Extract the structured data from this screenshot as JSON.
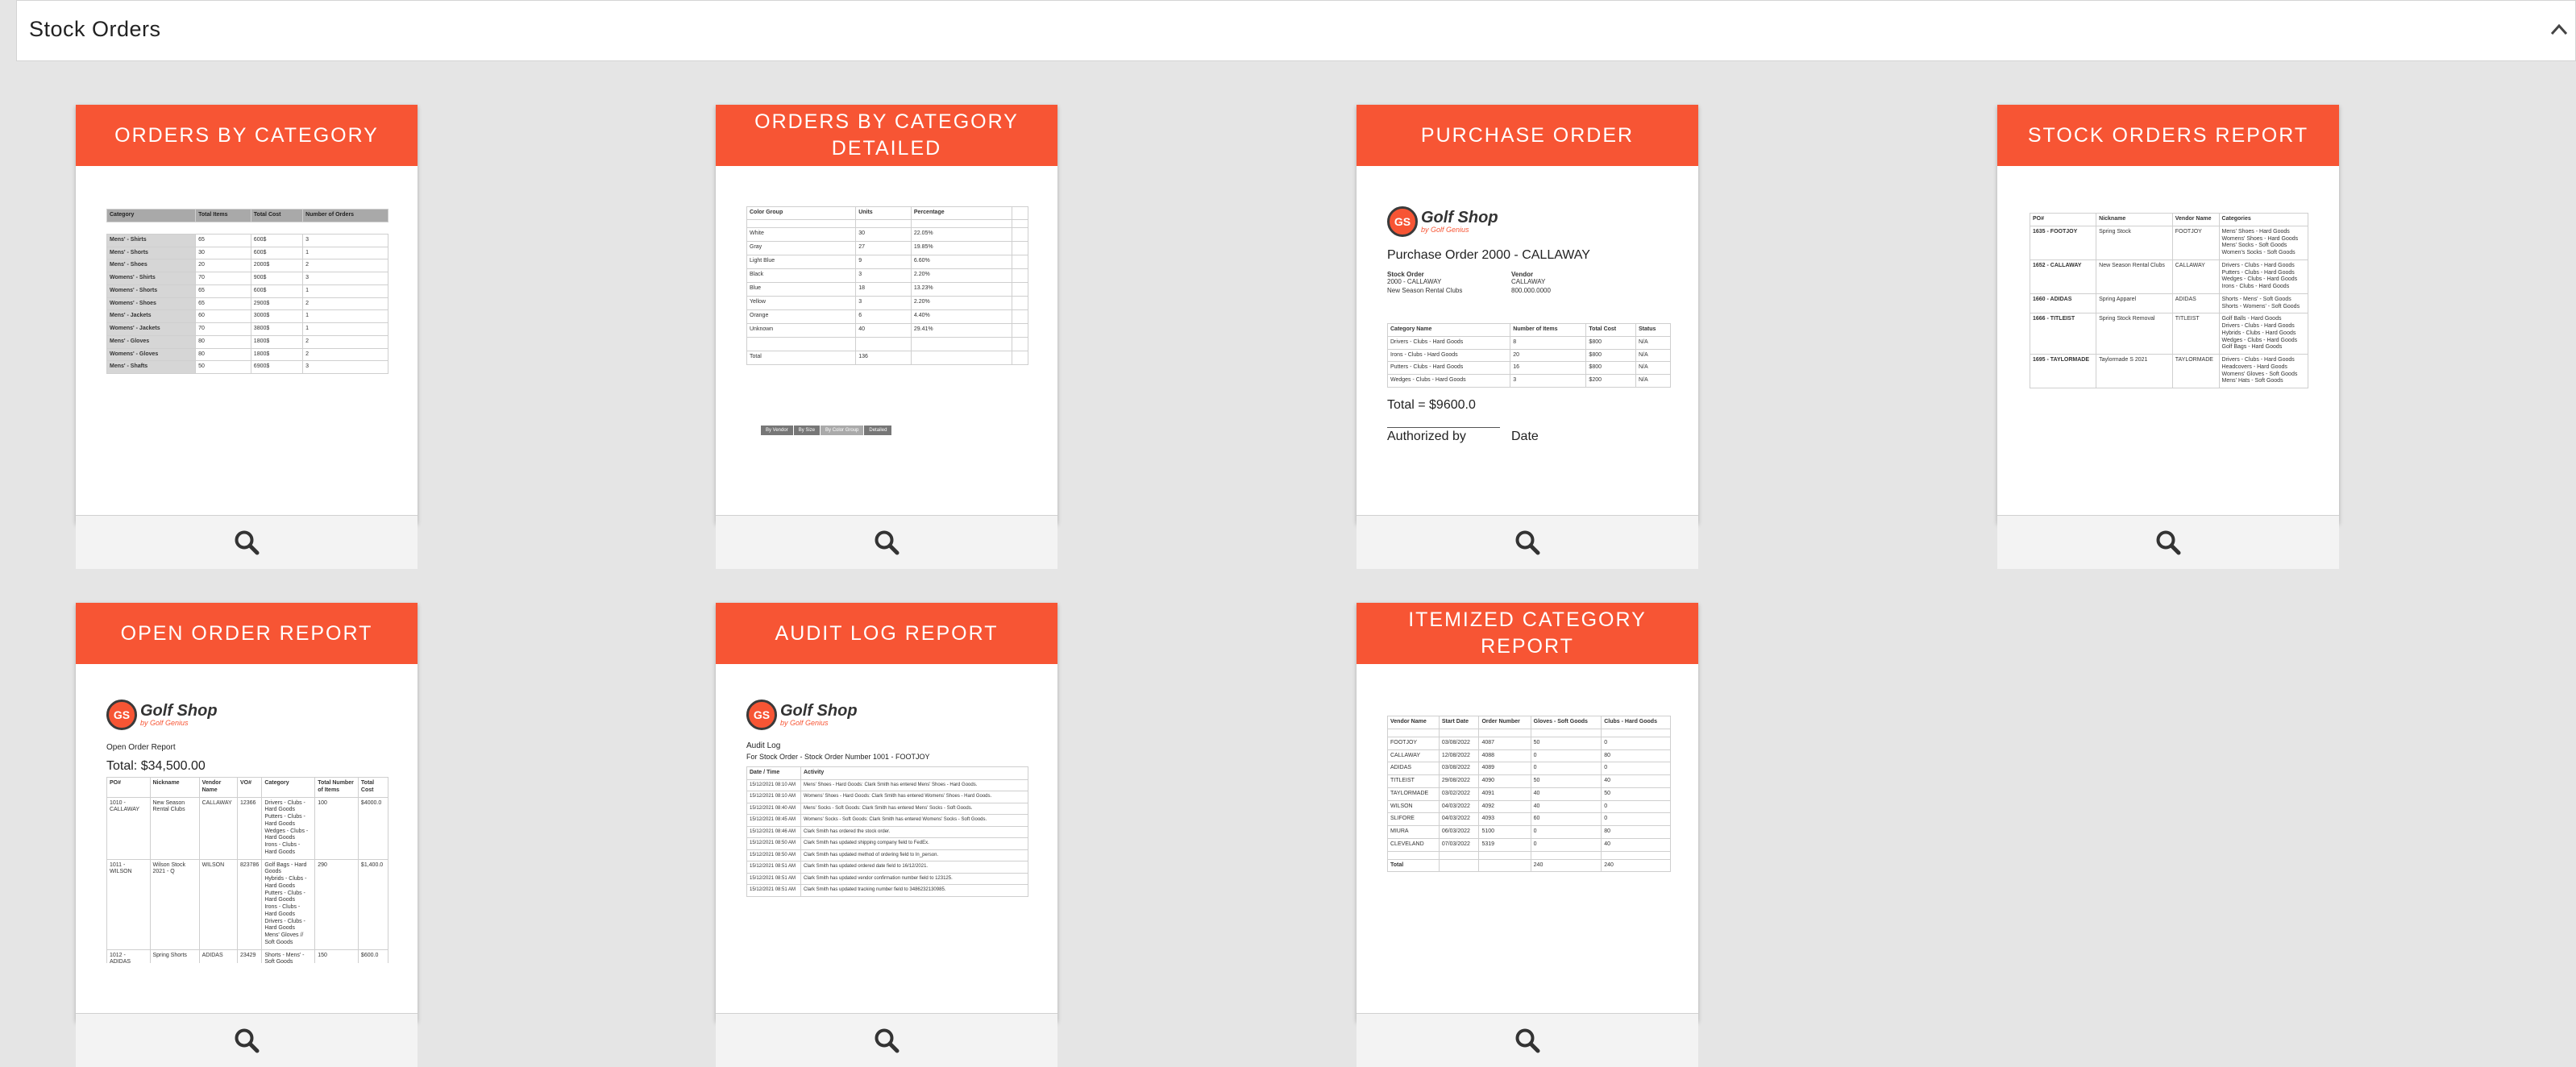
{
  "panel": {
    "title": "Stock Orders",
    "collapse_icon": "chevron-up-icon"
  },
  "accent_color": "#f75534",
  "search_icon": "magnifier-icon",
  "cards": [
    {
      "title": "ORDERS BY CATEGORY",
      "table": {
        "headers": [
          "Category",
          "Total Items",
          "Total Cost",
          "Number of Orders"
        ],
        "rows": [
          [
            "Mens' - Shirts",
            "65",
            "600$",
            "3"
          ],
          [
            "Mens' - Shorts",
            "30",
            "600$",
            "1"
          ],
          [
            "Mens' - Shoes",
            "20",
            "2000$",
            "2"
          ],
          [
            "Womens' - Shirts",
            "70",
            "900$",
            "3"
          ],
          [
            "Womens' - Shorts",
            "65",
            "600$",
            "1"
          ],
          [
            "Womens' - Shoes",
            "65",
            "2900$",
            "2"
          ],
          [
            "Mens' - Jackets",
            "60",
            "3000$",
            "1"
          ],
          [
            "Womens' - Jackets",
            "70",
            "3800$",
            "1"
          ],
          [
            "Mens' - Gloves",
            "80",
            "1800$",
            "2"
          ],
          [
            "Womens' - Gloves",
            "80",
            "1800$",
            "2"
          ],
          [
            "Mens' - Shafts",
            "50",
            "6900$",
            "3"
          ]
        ]
      }
    },
    {
      "title": "ORDERS BY CATEGORY DETAILED",
      "table": {
        "headers": [
          "Color Group",
          "Units",
          "Percentage",
          ""
        ],
        "rows": [
          [
            "White",
            "30",
            "22.05%",
            ""
          ],
          [
            "Gray",
            "27",
            "19.85%",
            ""
          ],
          [
            "Light Blue",
            "9",
            "6.60%",
            ""
          ],
          [
            "Black",
            "3",
            "2.20%",
            ""
          ],
          [
            "Blue",
            "18",
            "13.23%",
            ""
          ],
          [
            "Yellow",
            "3",
            "2.20%",
            ""
          ],
          [
            "Orange",
            "6",
            "4.40%",
            ""
          ],
          [
            "Unknown",
            "40",
            "29.41%",
            ""
          ]
        ],
        "total_label": "Total",
        "total_value": "136"
      },
      "buttons": [
        "By Vendor",
        "By Size",
        "By Color Group",
        "Detailed"
      ]
    },
    {
      "title": "PURCHASE ORDER",
      "logo": {
        "initials": "GS",
        "name": "Golf Shop",
        "sub": "by Golf Genius"
      },
      "heading": "Purchase Order 2000 - CALLAWAY",
      "stock_order_label": "Stock Order",
      "stock_order_lines": [
        "2000 - CALLAWAY",
        "New Season Rental Clubs"
      ],
      "vendor_label": "Vendor",
      "vendor_lines": [
        "CALLAWAY",
        "800.000.0000"
      ],
      "table": {
        "headers": [
          "Category Name",
          "Number of Items",
          "Total Cost",
          "Status"
        ],
        "rows": [
          [
            "Drivers - Clubs - Hard Goods",
            "8",
            "$800",
            "N/A"
          ],
          [
            "Irons - Clubs - Hard Goods",
            "20",
            "$800",
            "N/A"
          ],
          [
            "Putters - Clubs - Hard Goods",
            "16",
            "$800",
            "N/A"
          ],
          [
            "Wedges - Clubs - Hard Goods",
            "3",
            "$200",
            "N/A"
          ]
        ]
      },
      "total": "Total = $9600.0",
      "authorized_by": "Authorized by",
      "date": "Date"
    },
    {
      "title": "STOCK ORDERS REPORT",
      "table": {
        "headers": [
          "PO#",
          "Nickname",
          "Vendor Name",
          "Categories"
        ],
        "rows": [
          [
            "1635 - FOOTJOY",
            "Spring Stock",
            "FOOTJOY",
            "Mens' Shoes - Hard Goods\nWomens' Shoes - Hard Goods\nMens' Socks - Soft Goods\nWomen's Socks - Soft Goods"
          ],
          [
            "1652 - CALLAWAY",
            "New Season Rental Clubs",
            "CALLAWAY",
            "Drivers - Clubs - Hard Goods\nPutters - Clubs - Hard Goods\nWedges - Clubs - Hard Goods\nIrons - Clubs - Hard Goods"
          ],
          [
            "1660 - ADIDAS",
            "Spring Apparel",
            "ADIDAS",
            "Shorts - Mens' - Soft Goods\nShorts - Womens' - Soft Goods"
          ],
          [
            "1666 - TITLEIST",
            "Spring Stock Removal",
            "TITLEIST",
            "Golf Balls - Hard Goods\nDrivers - Clubs - Hard Goods\nHybrids - Clubs - Hard Goods\nWedges - Clubs - Hard Goods\nGolf Bags - Hard Goods"
          ],
          [
            "1695 - TAYLORMADE",
            "Taylormade S 2021",
            "TAYLORMADE",
            "Drivers - Clubs - Hard Goods\nHeadcovers - Hard Goods\nWomens' Gloves - Soft Goods\nMens' Hats - Soft Goods"
          ]
        ]
      }
    },
    {
      "title": "OPEN ORDER REPORT",
      "logo": {
        "initials": "GS",
        "name": "Golf Shop",
        "sub": "by Golf Genius"
      },
      "heading": "Open Order Report",
      "total": "Total: $34,500.00",
      "table": {
        "headers": [
          "PO#",
          "Nickname",
          "Vendor Name",
          "VO#",
          "Category",
          "Total Number of Items",
          "Total Cost"
        ],
        "rows": [
          [
            "1010 - CALLAWAY",
            "New Season Rental Clubs",
            "CALLAWAY",
            "12366",
            "Drivers - Clubs - Hard Goods\nPutters - Clubs - Hard Goods\nWedges - Clubs - Hard Goods\nIrons - Clubs - Hard Goods",
            "100",
            "$4000.0"
          ],
          [
            "1011 - WILSON",
            "Wilson Stock 2021 - Q",
            "WILSON",
            "823786",
            "Golf Bags - Hard Goods\nHybrids - Clubs - Hard Goods\nPutters - Clubs - Hard Goods\nIrons - Clubs - Hard Goods\nDrivers - Clubs - Hard Goods\nMens' Gloves // Soft Goods",
            "290",
            "$1,400.0"
          ],
          [
            "1012 - ADIDAS",
            "Spring Shorts",
            "ADIDAS",
            "23429",
            "Shorts - Mens' - Soft Goods\nShorts - Womens' - Soft Goods",
            "150",
            "$600.0"
          ]
        ]
      }
    },
    {
      "title": "AUDIT LOG REPORT",
      "logo": {
        "initials": "GS",
        "name": "Golf Shop",
        "sub": "by Golf Genius"
      },
      "heading": "Audit Log",
      "subheading": "For Stock Order - Stock Order Number 1001 - FOOTJOY",
      "table": {
        "headers": [
          "Date / Time",
          "Activity"
        ],
        "rows": [
          [
            "15/12/2021 08:10 AM",
            "Mens' Shoes - Hard Goods: Clark Smith has entered Mens' Shoes - Hard Goods."
          ],
          [
            "15/12/2021 08:10 AM",
            "Womens' Shoes - Hard Goods: Clark Smith has entered Womens' Shoes - Hard Goods."
          ],
          [
            "15/12/2021 08:40 AM",
            "Mens' Socks - Soft Goods: Clark Smith has entered Mens' Socks - Soft Goods."
          ],
          [
            "15/12/2021 08:45 AM",
            "Womens' Socks - Soft Goods: Clark Smith has entered Womens' Socks - Soft Goods."
          ],
          [
            "15/12/2021 08:46 AM",
            "Clark Smith has ordered the stock order."
          ],
          [
            "15/12/2021 08:50 AM",
            "Clark Smith has updated shipping company field to FedEx."
          ],
          [
            "15/12/2021 08:50 AM",
            "Clark Smith has updated method of ordering field to In_person."
          ],
          [
            "15/12/2021 08:51 AM",
            "Clark Smith has updated ordered date field to 16/12/2021."
          ],
          [
            "15/12/2021 08:51 AM",
            "Clark Smith has updated vendor confirmation number field to 123125."
          ],
          [
            "15/12/2021 08:51 AM",
            "Clark Smith has updated tracking number field to 3486232130985."
          ]
        ]
      }
    },
    {
      "title": "ITEMIZED CATEGORY REPORT",
      "table": {
        "headers": [
          "Vendor Name",
          "Start Date",
          "Order Number",
          "Gloves - Soft Goods",
          "Clubs - Hard Goods"
        ],
        "rows": [
          [
            "FOOTJOY",
            "03/08/2022",
            "4087",
            "50",
            "0"
          ],
          [
            "CALLAWAY",
            "12/08/2022",
            "4088",
            "0",
            "80"
          ],
          [
            "ADIDAS",
            "03/08/2022",
            "4089",
            "0",
            "0"
          ],
          [
            "TITLEIST",
            "29/08/2022",
            "4090",
            "50",
            "40"
          ],
          [
            "TAYLORMADE",
            "03/02/2022",
            "4091",
            "40",
            "50"
          ],
          [
            "WILSON",
            "04/03/2022",
            "4092",
            "40",
            "0"
          ],
          [
            "SLIFORE",
            "04/03/2022",
            "4093",
            "60",
            "0"
          ],
          [
            "MIURA",
            "06/03/2022",
            "5100",
            "0",
            "80"
          ],
          [
            "CLEVELAND",
            "07/03/2022",
            "5319",
            "0",
            "40"
          ]
        ],
        "total_label": "Total",
        "totals": [
          "",
          "",
          "240",
          "240"
        ]
      }
    }
  ]
}
